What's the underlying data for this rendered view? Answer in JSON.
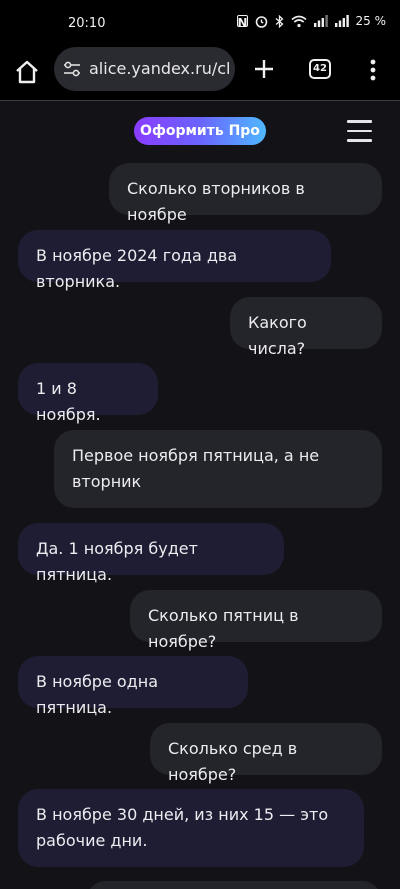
{
  "status_bar": {
    "time": "20:10",
    "battery": "25 %",
    "icons": [
      "nfc-icon",
      "alarm-icon",
      "bluetooth-icon",
      "wifi-icon",
      "signal-icon",
      "signal-icon"
    ]
  },
  "browser": {
    "url": "alice.yandex.ru/cl",
    "tab_count": "42",
    "icons": [
      "home-icon",
      "site-settings-icon",
      "new-tab-plus-icon",
      "more-menu-icon"
    ]
  },
  "header": {
    "pro_button": "Оформить Про",
    "menu_icon": "hamburger-menu-icon",
    "pro_gradient": [
      "#8a3cff",
      "#6a64ff",
      "#4fb8ff"
    ]
  },
  "messages": [
    {
      "role": "user",
      "text": "Сколько вторников в ноябре"
    },
    {
      "role": "bot",
      "text": "В ноябре 2024 года два вторника."
    },
    {
      "role": "user",
      "text": "Какого числа?"
    },
    {
      "role": "bot",
      "text": "1 и 8 ноября."
    },
    {
      "role": "user",
      "text": "Первое ноября пятница, а не вторник"
    },
    {
      "role": "bot",
      "text": "Да. 1 ноября будет пятница."
    },
    {
      "role": "user",
      "text": "Сколько пятниц в ноябре?"
    },
    {
      "role": "bot",
      "text": "В ноябре одна пятница."
    },
    {
      "role": "user",
      "text": "Сколько сред в ноябре?"
    },
    {
      "role": "bot",
      "text": "В ноябре 30 дней, из них 15 — это рабочие дни."
    }
  ],
  "colors": {
    "background": "#121217",
    "user_bubble": "#24252b",
    "bot_bubble": "#1f1d33"
  }
}
